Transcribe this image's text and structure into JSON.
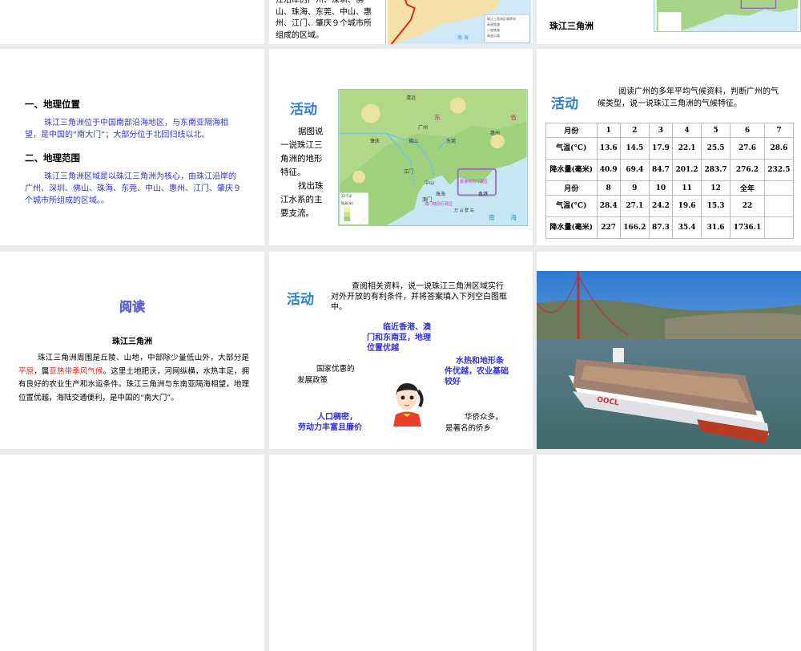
{
  "slides": {
    "s2": {
      "text": "江沿岸的广州、深圳、佛山、珠海、东莞、中山、惠州、江门、肇庆９个城市所组成的区域。",
      "legend": [
        "珠江三角洲区域界线",
        "高速铁路",
        "一般铁路",
        "高速公路"
      ],
      "sea": "南 海"
    },
    "s3": {
      "title": "珠江三角洲"
    },
    "s4": {
      "h1": "一、地理位置",
      "p1": "珠江三角洲位于中国南部沿海地区，与东南亚隔海相望，是中国的“南大门”；大部分位于北回归线以北。",
      "h2": "二、地理范围",
      "p2": "珠江三角洲区域是以珠江三角洲为核心，由珠江沿岸的广州、深圳、佛山、珠海、东莞、中山、惠州、江门、肇庆９个城市所组成的区域。。"
    },
    "s5": {
      "title": "活动",
      "p1": "据图说一说珠江三角洲的地形特征。",
      "p2": "找出珠江水系的主要支流。",
      "map_labels": [
        "清远",
        "广州",
        "佛山",
        "东莞",
        "惠州",
        "肇庆",
        "江门",
        "中山",
        "珠海",
        "澳门",
        "香港",
        "东",
        "省",
        "南",
        "海",
        "香港特别行政区",
        "澳门特别行政区",
        "万 山 群 岛"
      ],
      "legend_title": "陆高(米)",
      "scale": "20千米"
    },
    "s6": {
      "title": "活动",
      "intro": "阅读广州的多年平均气候资料，判断广州的气候类型，说一说珠江三角洲的气候特征。",
      "table": [
        [
          "月份",
          "1",
          "2",
          "3",
          "4",
          "5",
          "6",
          "7"
        ],
        [
          "气温(°C)",
          "13.6",
          "14.5",
          "17.9",
          "22.1",
          "25.5",
          "27.6",
          "28.6"
        ],
        [
          "降水量(毫米)",
          "40.9",
          "69.4",
          "84.7",
          "201.2",
          "283.7",
          "276.2",
          "232.5"
        ],
        [
          "月份",
          "8",
          "9",
          "10",
          "11",
          "12",
          "全年",
          ""
        ],
        [
          "气温(°C)",
          "28.4",
          "27.1",
          "24.2",
          "19.6",
          "15.3",
          "22",
          ""
        ],
        [
          "降水量(毫米)",
          "227",
          "166.2",
          "87.3",
          "35.4",
          "31.6",
          "1736.1",
          ""
        ]
      ]
    },
    "s7": {
      "title": "阅读",
      "subtitle": "珠江三角洲",
      "p_a": "珠江三角洲周围是丘陵、山地，中部除少量低山外，大部分是",
      "red1": "平原",
      "p_b": "，属",
      "red2": "亚热带季风气候",
      "p_c": "。这里土地肥沃，河网纵横，水热丰足，拥有良好的农业生产和水运条件。珠江三角洲与东南亚隔海相望，地理位置优越，海陆交通便利，是中国的“南大门”。"
    },
    "s8": {
      "title": "活动",
      "intro": "查阅相关资料，说一说珠江三角洲区域实行对外开放的有利条件，并将答案填入下列空白图框中。",
      "a1": "临近香港、澳门和东南亚，地理位置优越",
      "a2": "国家优惠的发展政策",
      "a3": "水热和地形条件优越，农业基础较好",
      "a4": "人口稠密，劳动力丰富且廉价",
      "a5": "华侨众多，是著名的侨乡"
    },
    "s9": {
      "ship_text": "OOCL"
    }
  }
}
